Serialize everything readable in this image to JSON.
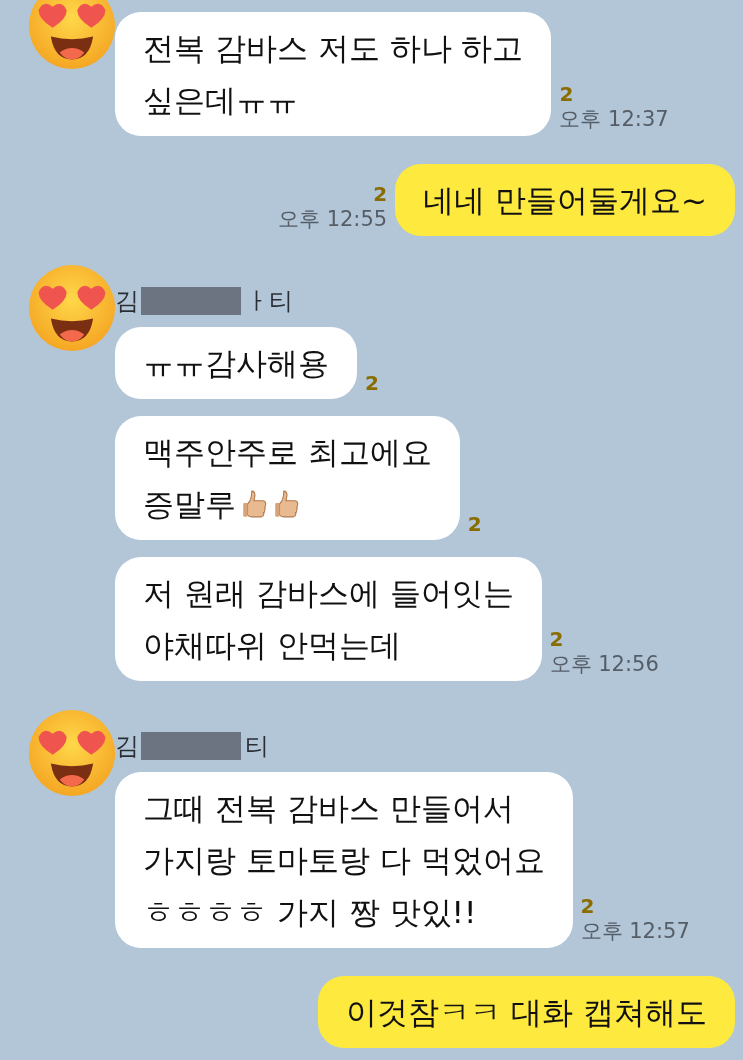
{
  "messages": [
    {
      "kind": "incoming",
      "bubbles": [
        {
          "lines": [
            {
              "text": "전복 감바스 저도 하나 하고"
            },
            {
              "text": "싶은데ㅠㅠ"
            }
          ],
          "unread": "2",
          "time": "오후 12:37"
        }
      ]
    },
    {
      "kind": "outgoing",
      "bubbles": [
        {
          "lines": [
            {
              "text": "네네 만들어둘게요~"
            }
          ],
          "unread": "2",
          "time": "오후 12:55"
        }
      ]
    },
    {
      "kind": "incoming",
      "sender": {
        "parts": [
          "김",
          "ㅏ티"
        ]
      },
      "bubbles": [
        {
          "lines": [
            {
              "text": "ㅠㅠ감사해용"
            }
          ],
          "unread": "2"
        },
        {
          "lines": [
            {
              "text": "맥주안주로 최고에요"
            },
            {
              "text": "증말루",
              "icons": [
                {
                  "kind": "thumbs_up"
                },
                {
                  "kind": "thumbs_up"
                }
              ]
            }
          ],
          "unread": "2"
        },
        {
          "lines": [
            {
              "text": "저 원래 감바스에 들어잇는"
            },
            {
              "text": "야채따위 안먹는데"
            }
          ],
          "unread": "2",
          "time": "오후 12:56"
        }
      ]
    },
    {
      "kind": "incoming",
      "sender": {
        "parts": [
          "김",
          "티"
        ]
      },
      "bubbles": [
        {
          "lines": [
            {
              "text": "그때 전복 감바스 만들어서"
            },
            {
              "text": "가지랑 토마토랑 다 먹었어요"
            },
            {
              "text": "ㅎㅎㅎㅎ 가지 짱 맛있!!"
            }
          ],
          "unread": "2",
          "time": "오후 12:57"
        }
      ]
    },
    {
      "kind": "outgoing",
      "bubbles": [
        {
          "lines": [
            {
              "text": "이것참ㅋㅋ 대화 캡쳐해도"
            }
          ]
        }
      ]
    }
  ]
}
